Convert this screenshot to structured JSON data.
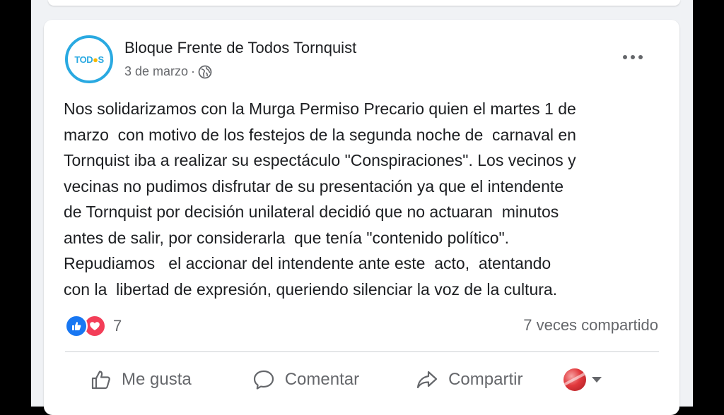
{
  "post": {
    "author": "Bloque Frente de Todos Tornquist",
    "avatar_text_a": "TOD",
    "avatar_text_b": "●",
    "avatar_text_c": "S",
    "date": "3 de marzo",
    "separator": "·",
    "privacy_icon": "globe-icon",
    "body": "Nos solidarizamos con la Murga Permiso Precario quien el martes 1 de\nmarzo  con motivo de los festejos de la segunda noche de  carnaval en\nTornquist iba a realizar su espectáculo \"Conspiraciones\". Los vecinos y\nvecinas no pudimos disfrutar de su presentación ya que el intendente\nde Tornquist por decisión unilateral decidió que no actuaran  minutos\nantes de salir, por considerarla  que tenía \"contenido político\".\nRepudiamos   el accionar del intendente ante este  acto,  atentando\ncon la  libertad de expresión, queriendo silenciar la voz de la cultura."
  },
  "stats": {
    "reaction_count": "7",
    "shares": "7 veces compartido"
  },
  "actions": {
    "like": "Me gusta",
    "comment": "Comentar",
    "share": "Compartir"
  },
  "colors": {
    "brand_blue": "#1877f2",
    "love_red": "#f33e58",
    "avatar_blue": "#29a9e1",
    "avatar_yellow": "#f5b800"
  }
}
